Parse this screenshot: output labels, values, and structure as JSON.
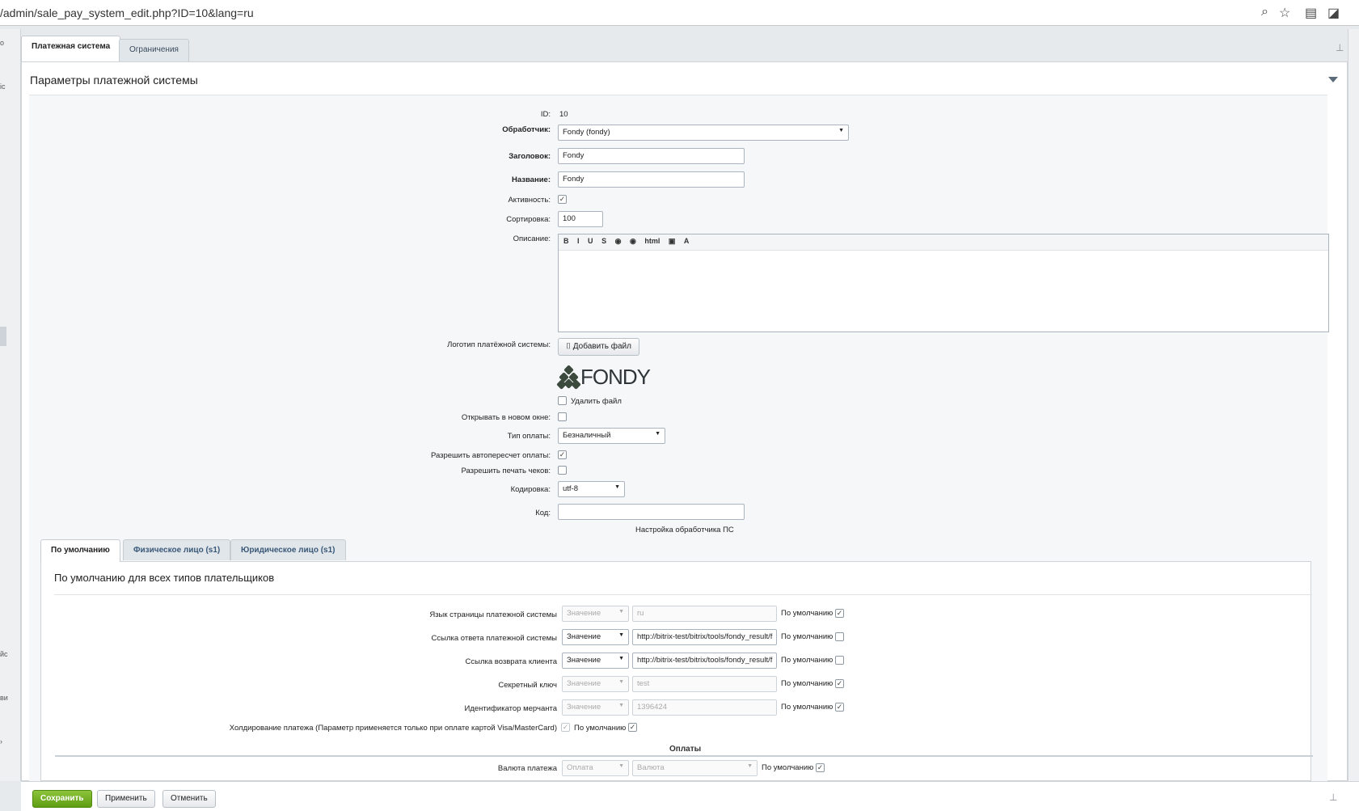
{
  "browser": {
    "url": "/admin/sale_pay_system_edit.php?ID=10&lang=ru"
  },
  "left_strip": {
    "c1": "о",
    "c2": "іс",
    "c3": "йс",
    "c4": "ви"
  },
  "tabs": [
    {
      "label": "Платежная система"
    },
    {
      "label": "Ограничения"
    }
  ],
  "panel": {
    "title": "Параметры платежной системы"
  },
  "form": {
    "id_label": "ID:",
    "id_value": "10",
    "handler_label": "Обработчик:",
    "handler_value": "Fondy (fondy)",
    "header_label": "Заголовок:",
    "header_value": "Fondy",
    "name_label": "Название:",
    "name_value": "Fondy",
    "active_label": "Активность:",
    "sort_label": "Сортировка:",
    "sort_value": "100",
    "desc_label": "Описание:",
    "editor_tools": [
      "B",
      "I",
      "U",
      "S",
      "◉",
      "◉",
      "html",
      "▣",
      "A"
    ],
    "logo_label": "Логотип платёжной системы:",
    "add_file": "Добавить файл",
    "logo_text": "FONDY",
    "delete_file": "Удалить файл",
    "new_window_label": "Открывать в новом окне:",
    "pay_type_label": "Тип оплаты:",
    "pay_type_value": "Безналичный",
    "auto_recalc_label": "Разрешить автопересчет оплаты:",
    "print_checks_label": "Разрешить печать чеков:",
    "encoding_label": "Кодировка:",
    "encoding_value": "utf-8",
    "code_label": "Код:",
    "code_value": "",
    "handler_settings": "Настройка обработчика ПС"
  },
  "subtabs": [
    {
      "label": "По умолчанию"
    },
    {
      "label": "Физическое лицо (s1)"
    },
    {
      "label": "Юридическое лицо (s1)"
    }
  ],
  "params": {
    "title": "По умолчанию для всех типов плательщиков",
    "default_label": "По умолчанию",
    "value_option": "Значение",
    "rows": [
      {
        "label": "Язык страницы платежной системы",
        "value": "ru"
      },
      {
        "label": "Ссылка ответа платежной системы",
        "value": "http://bitrix-test/bitrix/tools/fondy_result/f"
      },
      {
        "label": "Ссылка возврата клиента",
        "value": "http://bitrix-test/bitrix/tools/fondy_result/f"
      },
      {
        "label": "Секретный ключ",
        "value": "test"
      },
      {
        "label": "Идентификатор мерчанта",
        "value": "1396424"
      }
    ],
    "hold_label": "Холдирование платежа (Параметр применяется только при оплате картой Visa/MasterCard)",
    "payments_section": "Оплаты",
    "currency_label": "Валюта платежа",
    "currency_sel1": "Оплата",
    "currency_sel2": "Валюта"
  },
  "footer": {
    "save": "Сохранить",
    "apply": "Применить",
    "cancel": "Отменить"
  }
}
